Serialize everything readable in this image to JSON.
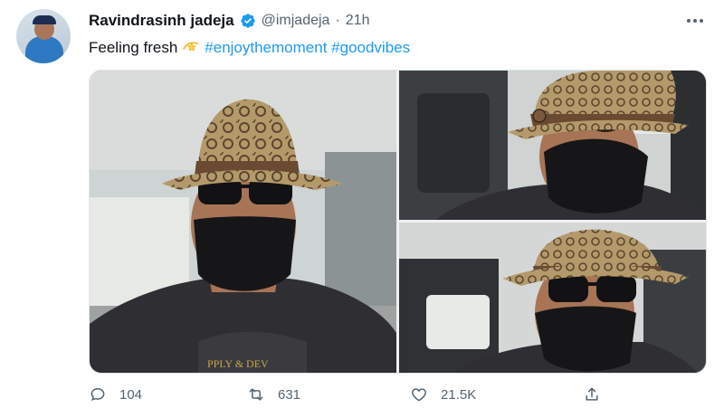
{
  "tweet": {
    "author_name": "Ravindrasinh jadeja",
    "handle": "@imjadeja",
    "separator": "·",
    "time": "21h",
    "text_prefix": "Feeling fresh",
    "hashtags": [
      "#enjoythemoment",
      "#goodvibes"
    ],
    "colors": {
      "accent": "#1d9bf0",
      "muted": "#536471",
      "text": "#0f1419"
    }
  },
  "actions": {
    "reply_count": "104",
    "retweet_count": "631",
    "like_count": "21.5K"
  },
  "icons": {
    "verified": "verified-badge-icon",
    "more": "more-options-icon",
    "emoji": "dizzy-emoji-icon",
    "reply": "reply-icon",
    "retweet": "retweet-icon",
    "like": "heart-icon",
    "share": "share-icon"
  }
}
